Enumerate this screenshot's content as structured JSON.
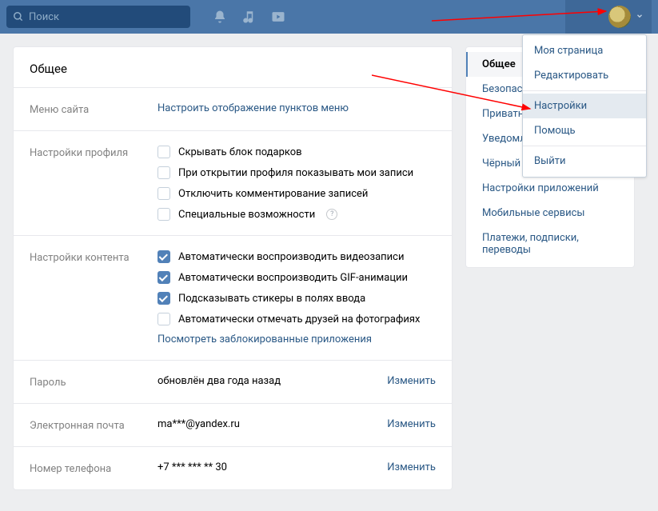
{
  "header": {
    "search_placeholder": "Поиск"
  },
  "dropdown": {
    "my_page": "Моя страница",
    "edit": "Редактировать",
    "settings": "Настройки",
    "help": "Помощь",
    "logout": "Выйти"
  },
  "main": {
    "title": "Общее",
    "menu": {
      "label": "Меню сайта",
      "link": "Настроить отображение пунктов меню"
    },
    "profile": {
      "label": "Настройки профиля",
      "opts": {
        "hide_gifts": "Скрывать блок подарков",
        "show_posts": "При открытии профиля показывать мои записи",
        "disable_comments": "Отключить комментирование записей",
        "accessibility": "Специальные возможности"
      }
    },
    "content": {
      "label": "Настройки контента",
      "opts": {
        "autoplay_video": "Автоматически воспроизводить видеозаписи",
        "autoplay_gif": "Автоматически воспроизводить GIF-анимации",
        "suggest_stickers": "Подсказывать стикеры в полях ввода",
        "autotag_friends": "Автоматически отмечать друзей на фотографиях"
      },
      "blocked_link": "Посмотреть заблокированные приложения"
    },
    "password": {
      "label": "Пароль",
      "value": "обновлён два года назад",
      "action": "Изменить"
    },
    "email": {
      "label": "Электронная почта",
      "value": "ma***@yandex.ru",
      "action": "Изменить"
    },
    "phone": {
      "label": "Номер телефона",
      "value": "+7 *** *** ** 30",
      "action": "Изменить"
    }
  },
  "side": {
    "items": [
      "Общее",
      "Безопасность",
      "Приватность",
      "Уведомления",
      "Чёрный список",
      "Настройки приложений",
      "Мобильные сервисы",
      "Платежи, подписки, переводы"
    ]
  }
}
